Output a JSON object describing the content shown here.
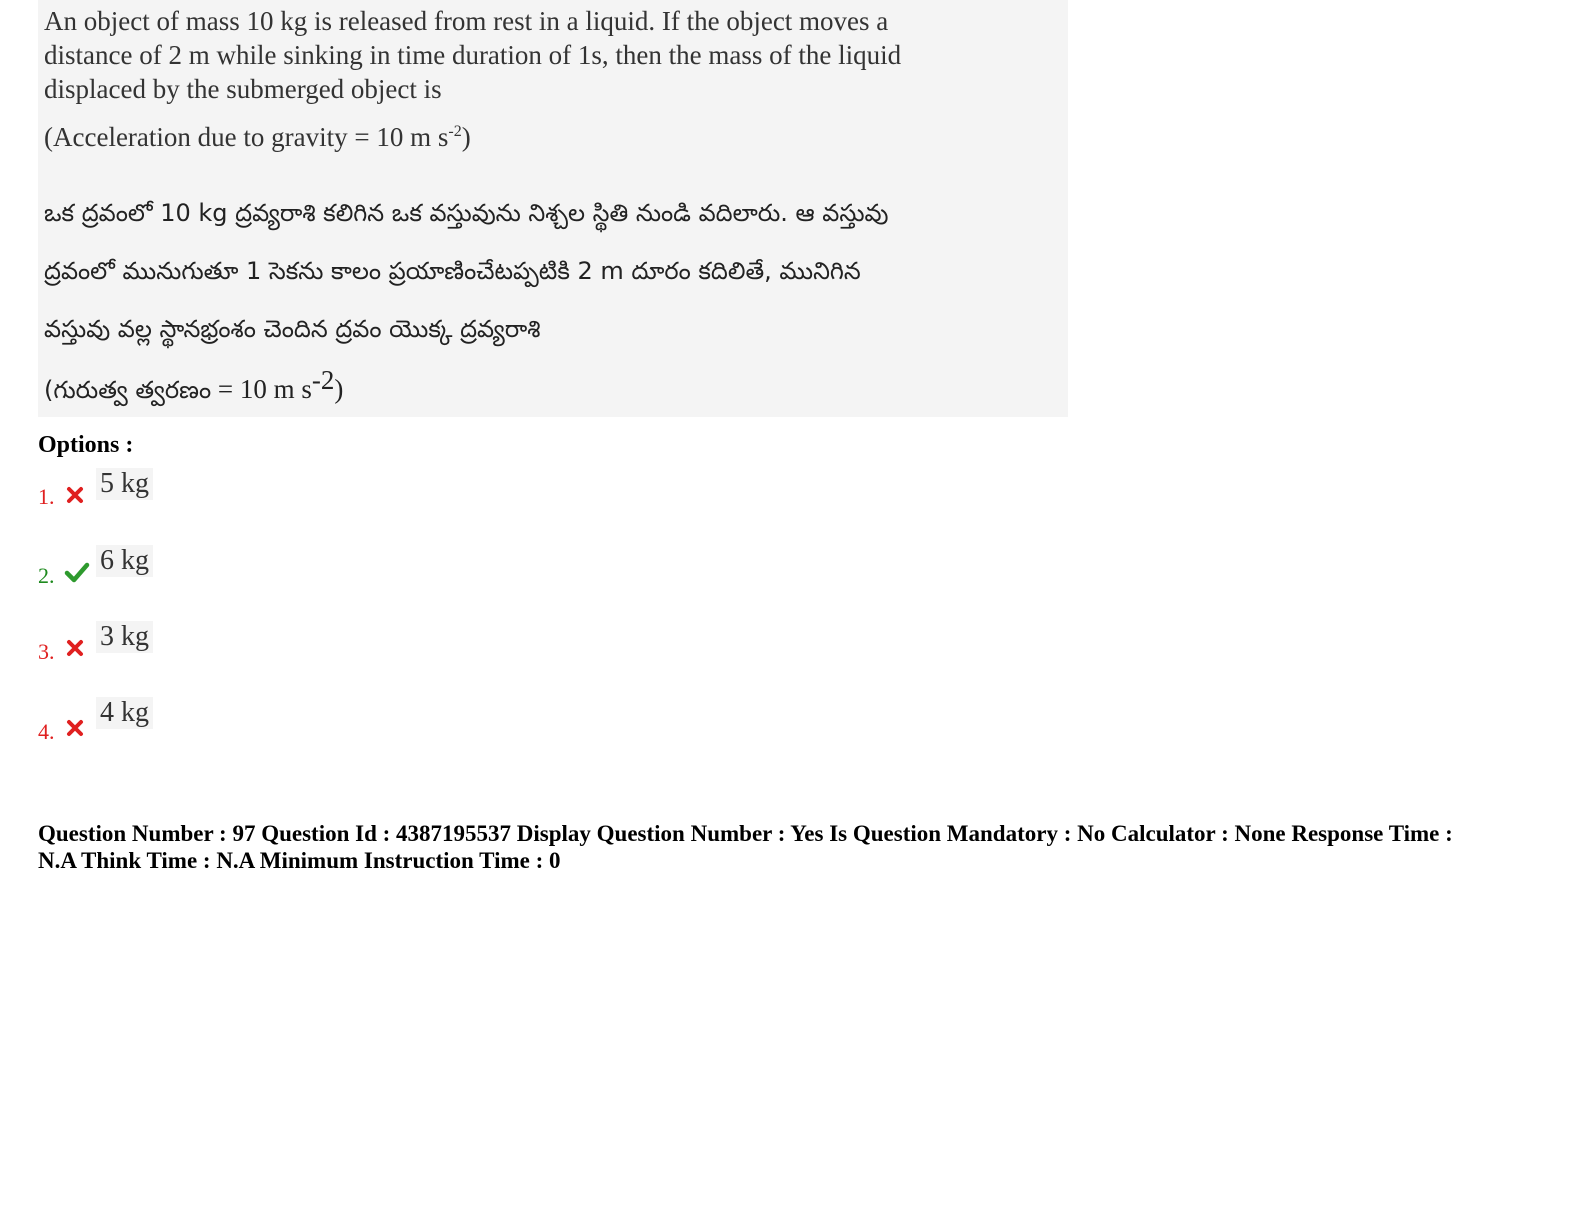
{
  "question": {
    "english_lines": [
      "An object of mass 10 kg is released from rest in a liquid.  If the object moves a",
      "distance of 2 m while sinking in time duration of 1s, then the mass of the liquid",
      "displaced by the submerged object is"
    ],
    "english_gravity_prefix": "(Acceleration due to gravity = 10 m s",
    "english_gravity_exp": "-2",
    "english_gravity_suffix": ")",
    "telugu_lines": [
      "ఒక ద్రవంలో 10 kg ద్రవ్యరాశి కలిగిన ఒక వస్తువును నిశ్చల స్థితి నుండి వదిలారు. ఆ వస్తువు",
      "ద్రవంలో మునుగుతూ 1 సెకను కాలం ప్రయాణించేటప్పటికి 2 m దూరం కదిలితే, మునిగిన",
      "వస్తువు వల్ల స్థానభ్రంశం చెందిన ద్రవం యొక్క ద్రవ్యరాశి"
    ],
    "telugu_gravity_prefix": "(గురుత్వ త్వరణం",
    "telugu_gravity_value": " = 10 m s",
    "telugu_gravity_exp": "-2",
    "telugu_gravity_suffix": ")"
  },
  "options_label": "Options :",
  "options": [
    {
      "number": "1.",
      "value": "5 kg",
      "status": "wrong",
      "icon": "cross-icon"
    },
    {
      "number": "2.",
      "value": "6 kg",
      "status": "correct",
      "icon": "check-icon"
    },
    {
      "number": "3.",
      "value": "3 kg",
      "status": "wrong",
      "icon": "cross-icon"
    },
    {
      "number": "4.",
      "value": "4 kg",
      "status": "wrong",
      "icon": "cross-icon"
    }
  ],
  "meta": {
    "line1": "Question Number : 97 Question Id : 4387195537 Display Question Number : Yes Is Question Mandatory : No Calculator : None Response Time :",
    "line2": "N.A Think Time : N.A Minimum Instruction Time : 0"
  },
  "colors": {
    "wrong": "#e02020",
    "correct": "#1e8a1e",
    "question_bg": "#f4f4f4"
  }
}
